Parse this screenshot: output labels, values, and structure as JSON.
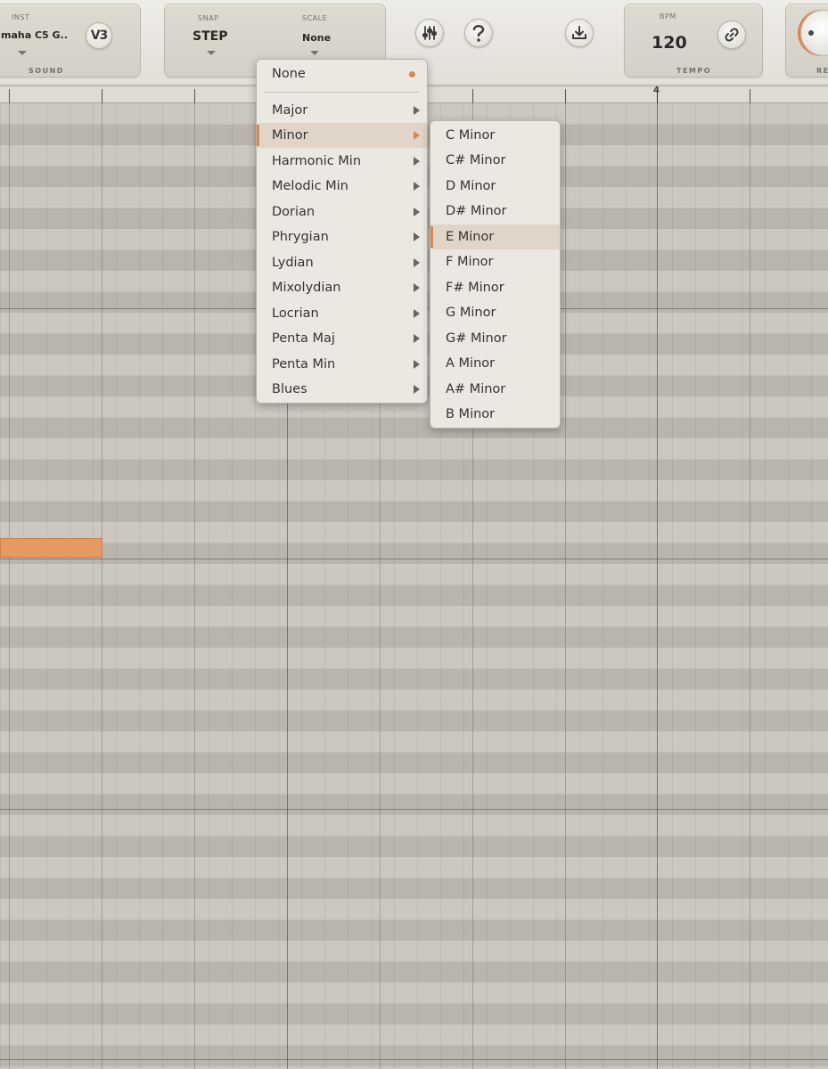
{
  "toolbar": {
    "sound": {
      "label": "INST",
      "value": "maha C5 G..",
      "footer": "SOUND",
      "version_badge": "V3"
    },
    "snap": {
      "label": "SNAP",
      "value": "STEP"
    },
    "scale": {
      "label": "SCALE",
      "value": "None"
    },
    "icons": {
      "mixer": "mixer-sliders-icon",
      "help": "help-question-icon",
      "download": "download-icon",
      "link": "link-icon"
    },
    "tempo": {
      "label": "BPM",
      "value": "120",
      "footer": "TEMPO"
    },
    "rec": {
      "footer": "RE"
    }
  },
  "ruler": {
    "bar_number": "4"
  },
  "scale_menu": {
    "none": "None",
    "items": [
      "Major",
      "Minor",
      "Harmonic Min",
      "Melodic Min",
      "Dorian",
      "Phrygian",
      "Lydian",
      "Mixolydian",
      "Locrian",
      "Penta Maj",
      "Penta Min",
      "Blues"
    ],
    "highlighted": "Minor"
  },
  "minor_submenu": {
    "items": [
      "C Minor",
      "C# Minor",
      "D Minor",
      "D# Minor",
      "E Minor",
      "F Minor",
      "F# Minor",
      "G Minor",
      "G# Minor",
      "A Minor",
      "A# Minor",
      "B Minor"
    ],
    "highlighted": "E Minor"
  },
  "colors": {
    "accent": "#d7874f",
    "note": "#e59a63",
    "highlight_bg": "#e1d4c8"
  }
}
